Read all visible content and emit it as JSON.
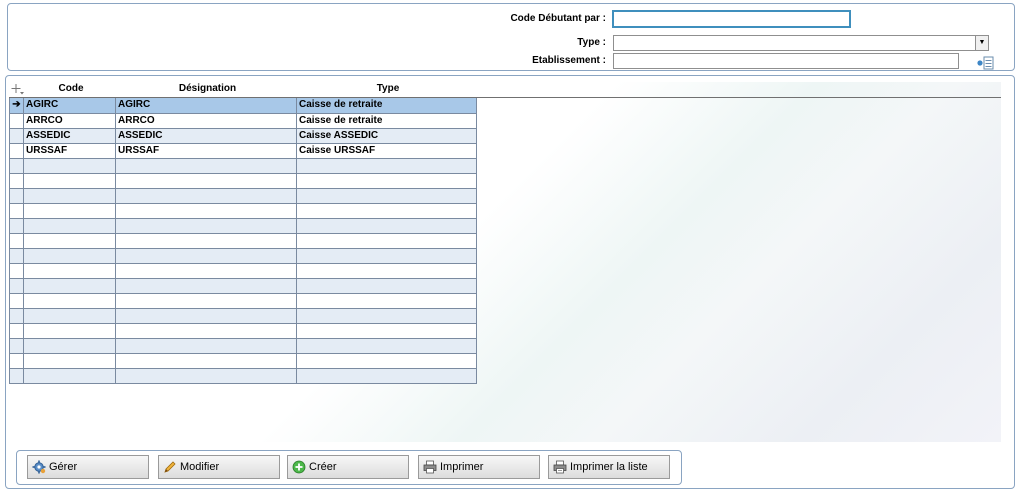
{
  "filters": {
    "code_label": "Code Débutant par :",
    "code_value": "",
    "type_label": "Type :",
    "type_value": "",
    "etab_label": "Etablissement :",
    "etab_value": ""
  },
  "grid": {
    "columns": [
      "Code",
      "Désignation",
      "Type"
    ],
    "rows": [
      {
        "code": "AGIRC",
        "designation": "AGIRC",
        "type": "Caisse de retraite"
      },
      {
        "code": "ARRCO",
        "designation": "ARRCO",
        "type": "Caisse de retraite"
      },
      {
        "code": "ASSEDIC",
        "designation": "ASSEDIC",
        "type": "Caisse ASSEDIC"
      },
      {
        "code": "URSSAF",
        "designation": "URSSAF",
        "type": "Caisse URSSAF"
      }
    ],
    "selected_row_marker": "➔"
  },
  "buttons": {
    "gerer": "Gérer",
    "modifier": "Modifier",
    "creer": "Créer",
    "imprimer": "Imprimer",
    "imprimer_liste": "Imprimer la liste"
  },
  "icons": {
    "gerer": "gear-icon",
    "modifier": "pencil-icon",
    "creer": "add-circle-icon",
    "imprimer": "printer-icon",
    "imprimer_liste": "printer-list-icon"
  },
  "colors": {
    "panel_border": "#8aa4c2",
    "focus_border": "#3f8fbd",
    "selected_row": "#a8c8e8",
    "alt_row": "#e4ecf5"
  }
}
